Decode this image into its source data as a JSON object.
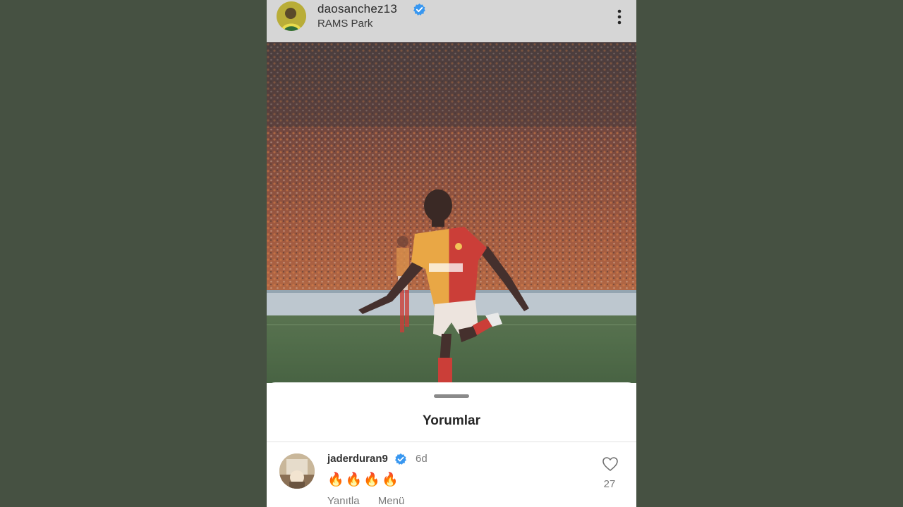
{
  "post": {
    "username": "daosanchez13",
    "location": "RAMS Park",
    "icons": {
      "verified": "verified-badge-icon",
      "more": "more-options-icon"
    }
  },
  "photo": {
    "subject": "football-player-celebrating-photo"
  },
  "comments_sheet": {
    "title": "Yorumlar",
    "comments": [
      {
        "username": "jaderduran9",
        "time": "6d",
        "text": "🔥🔥🔥🔥",
        "reply_label": "Yanıtla",
        "menu_label": "Menü",
        "likes": "27"
      }
    ]
  },
  "colors": {
    "background": "#465142",
    "verified": "#3897f0",
    "header_bg": "#d6d6d6"
  }
}
